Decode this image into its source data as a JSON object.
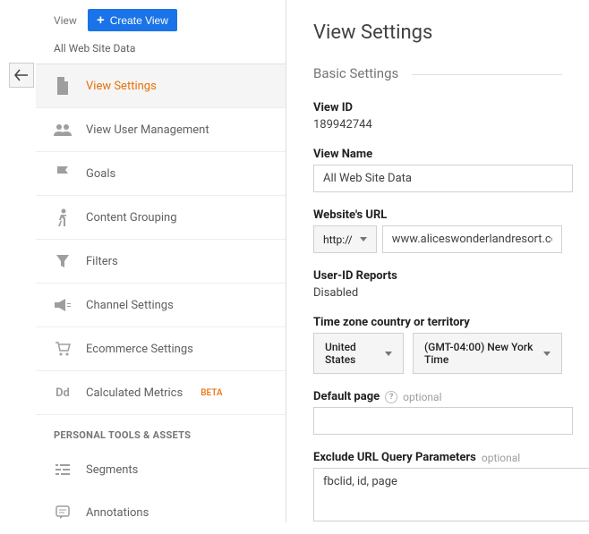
{
  "sidebar": {
    "view_label": "View",
    "create_view": "Create View",
    "subtitle": "All Web Site Data",
    "items": [
      {
        "label": "View Settings"
      },
      {
        "label": "View User Management"
      },
      {
        "label": "Goals"
      },
      {
        "label": "Content Grouping"
      },
      {
        "label": "Filters"
      },
      {
        "label": "Channel Settings"
      },
      {
        "label": "Ecommerce Settings"
      },
      {
        "label": "Calculated Metrics"
      }
    ],
    "beta_label": "BETA",
    "personal_section": "PERSONAL TOOLS & ASSETS",
    "personal_items": [
      {
        "label": "Segments"
      },
      {
        "label": "Annotations"
      }
    ]
  },
  "main": {
    "title": "View Settings",
    "basic_settings": "Basic Settings",
    "view_id_label": "View ID",
    "view_id_value": "189942744",
    "view_name_label": "View Name",
    "view_name_value": "All Web Site Data",
    "website_url_label": "Website's URL",
    "protocol": "http://",
    "url_value": "www.aliceswonderlandresort.com",
    "user_id_label": "User-ID Reports",
    "user_id_value": "Disabled",
    "timezone_label": "Time zone country or territory",
    "timezone_country": "United States",
    "timezone_value": "(GMT-04:00) New York Time",
    "default_page_label": "Default page",
    "optional_text": "optional",
    "default_page_value": "",
    "exclude_label": "Exclude URL Query Parameters",
    "exclude_value": "fbclid, id, page"
  }
}
